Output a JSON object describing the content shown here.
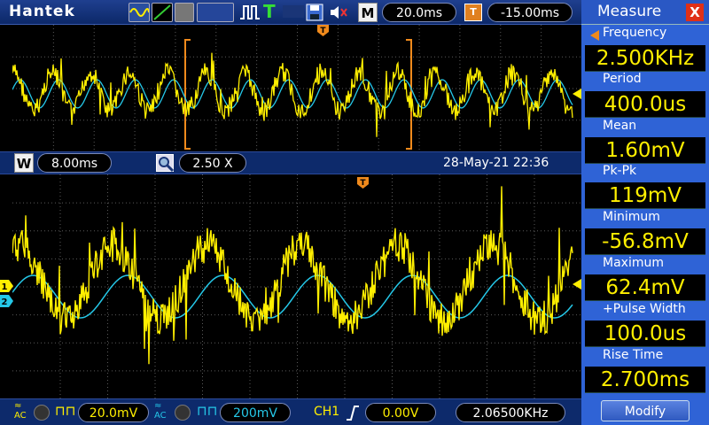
{
  "brand": "Hantek",
  "top": {
    "m_label": "M",
    "timebase": "20.0ms",
    "trigger_mark": "T",
    "trigger_offset": "-15.00ms"
  },
  "middle": {
    "w_label": "W",
    "window_timebase": "8.00ms",
    "zoom": "2.50 X",
    "datetime": "28-May-21 22:36"
  },
  "bottom": {
    "ch1_volts": "20.0mV",
    "ch2_volts": "200mV",
    "trigger_channel": "CH1",
    "trigger_level": "0.00V",
    "frequency": "2.06500KHz",
    "coupling_label": "AC"
  },
  "markers": {
    "ch1": "1",
    "ch2": "2"
  },
  "measure": {
    "title": "Measure",
    "close": "X",
    "source": "Frequency",
    "items": [
      {
        "label": "",
        "value": "2.500KHz"
      },
      {
        "label": "Period",
        "value": "400.0us"
      },
      {
        "label": "Mean",
        "value": "1.60mV"
      },
      {
        "label": "Pk-Pk",
        "value": "119mV"
      },
      {
        "label": "Minimum",
        "value": "-56.8mV"
      },
      {
        "label": "Maximum",
        "value": "62.4mV"
      },
      {
        "label": "+Pulse Width",
        "value": "100.0us"
      },
      {
        "label": "Rise Time",
        "value": "2.700ms"
      }
    ],
    "modify": "Modify"
  },
  "colors": {
    "ch1": "#ffef00",
    "ch2": "#25c8e8",
    "trigger": "#f08a1c",
    "grid": "#5a5a5a"
  }
}
